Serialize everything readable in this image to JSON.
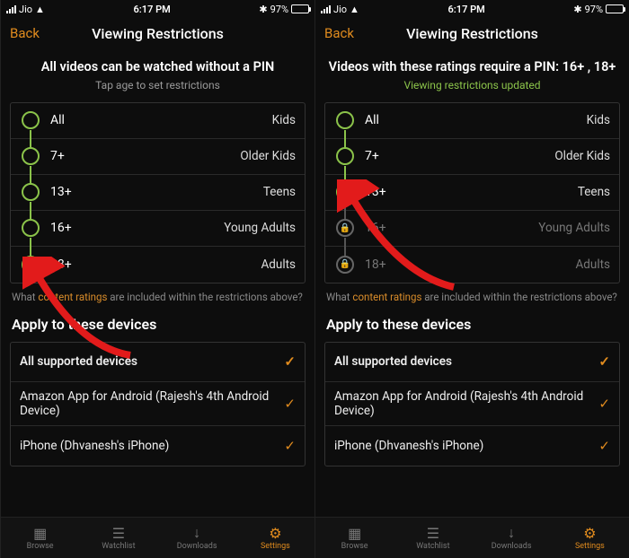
{
  "status": {
    "carrier": "Jio",
    "time": "6:17 PM",
    "battery": "97%"
  },
  "nav": {
    "back": "Back",
    "title": "Viewing Restrictions"
  },
  "left": {
    "heading": "All videos can be watched without a PIN",
    "sub": "Tap age to set restrictions",
    "ratings": [
      {
        "age": "All",
        "cat": "Kids"
      },
      {
        "age": "7+",
        "cat": "Older Kids"
      },
      {
        "age": "13+",
        "cat": "Teens"
      },
      {
        "age": "16+",
        "cat": "Young Adults"
      },
      {
        "age": "18+",
        "cat": "Adults"
      }
    ]
  },
  "right": {
    "heading": "Videos with these ratings require a PIN: 16+ , 18+",
    "sub": "Viewing restrictions updated",
    "ratings": [
      {
        "age": "All",
        "cat": "Kids"
      },
      {
        "age": "7+",
        "cat": "Older Kids"
      },
      {
        "age": "13+",
        "cat": "Teens"
      },
      {
        "age": "16+",
        "cat": "Young Adults"
      },
      {
        "age": "18+",
        "cat": "Adults"
      }
    ]
  },
  "ratings_link": {
    "pre": "What ",
    "accent": "content ratings",
    "post": " are included within the restrictions above?"
  },
  "devices": {
    "title": "Apply to these devices",
    "all": "All supported devices",
    "d1": "Amazon App for Android (Rajesh's 4th Android Device)",
    "d2": "iPhone (Dhvanesh's iPhone)"
  },
  "tabs": {
    "browse": "Browse",
    "watchlist": "Watchlist",
    "downloads": "Downloads",
    "settings": "Settings"
  }
}
